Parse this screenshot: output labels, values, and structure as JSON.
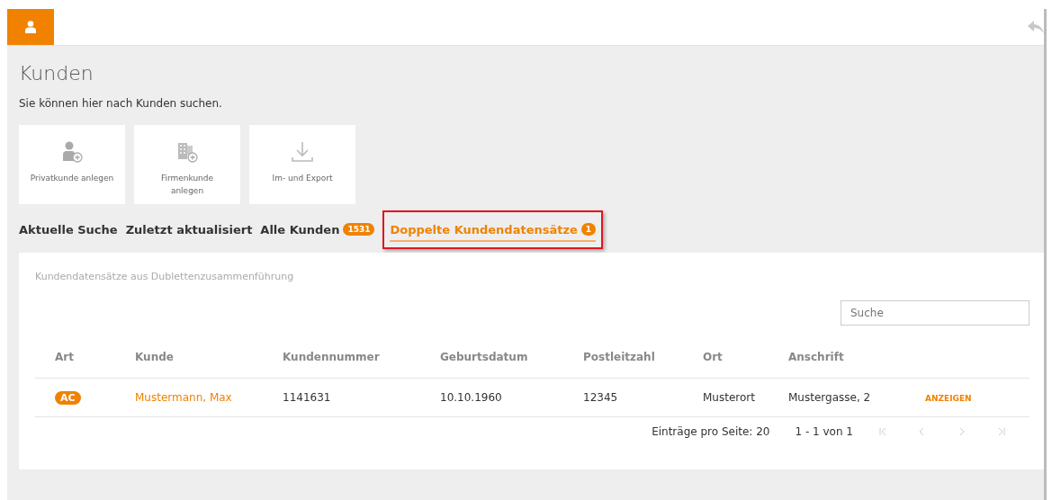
{
  "page": {
    "title": "Kunden",
    "subtitle": "Sie können hier nach Kunden suchen."
  },
  "tiles": [
    {
      "label": "Privatkunde anlegen",
      "kind": "person"
    },
    {
      "label": "Firmenkunde anlegen",
      "kind": "company"
    },
    {
      "label": "Im- und Export",
      "kind": "transfer"
    }
  ],
  "tabs": [
    {
      "label": "Aktuelle Suche",
      "selected": false
    },
    {
      "label": "Zuletzt aktualisiert",
      "selected": false
    },
    {
      "label": "Alle Kunden",
      "count": "1531",
      "selected": false
    },
    {
      "label": "Doppelte Kundendatensätze",
      "count": "1",
      "selected": true,
      "highlighted": true
    }
  ],
  "panel": {
    "title": "Kundendatensätze aus Dublettenzusammenführung",
    "search": {
      "placeholder": "Suche"
    }
  },
  "table": {
    "columns": [
      "Art",
      "Kunde",
      "Kundennummer",
      "Geburtsdatum",
      "Postleitzahl",
      "Ort",
      "Anschrift"
    ],
    "rows": [
      {
        "art": "AC",
        "kunde": "Mustermann, Max",
        "kundennummer": "1141631",
        "geburtsdatum": "10.10.1960",
        "postleitzahl": "12345",
        "ort": "Musterort",
        "anschrift": "Mustergasse, 2",
        "action": "ANZEIGEN"
      }
    ]
  },
  "pagination": {
    "per_page": "Einträge pro Seite: 20",
    "range": "1 - 1 von 1"
  }
}
